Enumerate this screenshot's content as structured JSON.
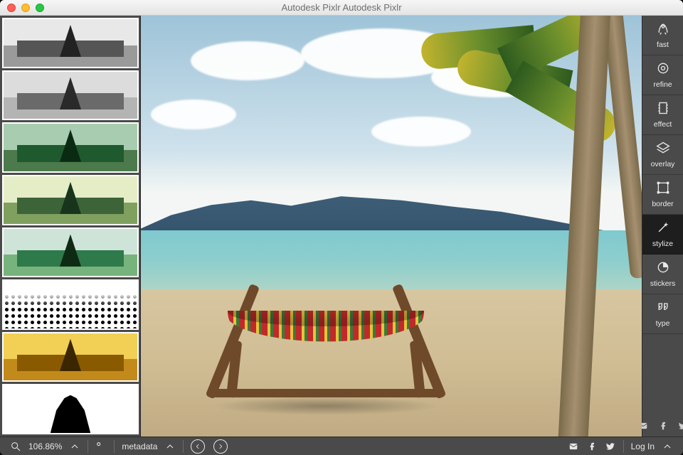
{
  "window": {
    "title": "Autodesk Pixlr  Autodesk Pixlr"
  },
  "zoom": {
    "value": "106.86%"
  },
  "metadata_label": "metadata",
  "login_label": "Log In",
  "tools": [
    {
      "id": "fast",
      "label": "fast",
      "icon": "rocket-icon"
    },
    {
      "id": "refine",
      "label": "refine",
      "icon": "target-icon"
    },
    {
      "id": "effect",
      "label": "effect",
      "icon": "filmstrip-icon"
    },
    {
      "id": "overlay",
      "label": "overlay",
      "icon": "layers-icon"
    },
    {
      "id": "border",
      "label": "border",
      "icon": "border-icon"
    },
    {
      "id": "stylize",
      "label": "stylize",
      "icon": "wand-icon",
      "selected": true
    },
    {
      "id": "stickers",
      "label": "stickers",
      "icon": "sticker-icon"
    },
    {
      "id": "type",
      "label": "type",
      "icon": "quote-icon"
    }
  ],
  "thumb_variants": [
    "v0",
    "v1",
    "v2",
    "v3",
    "v4",
    "v5",
    "v6",
    "v7"
  ]
}
